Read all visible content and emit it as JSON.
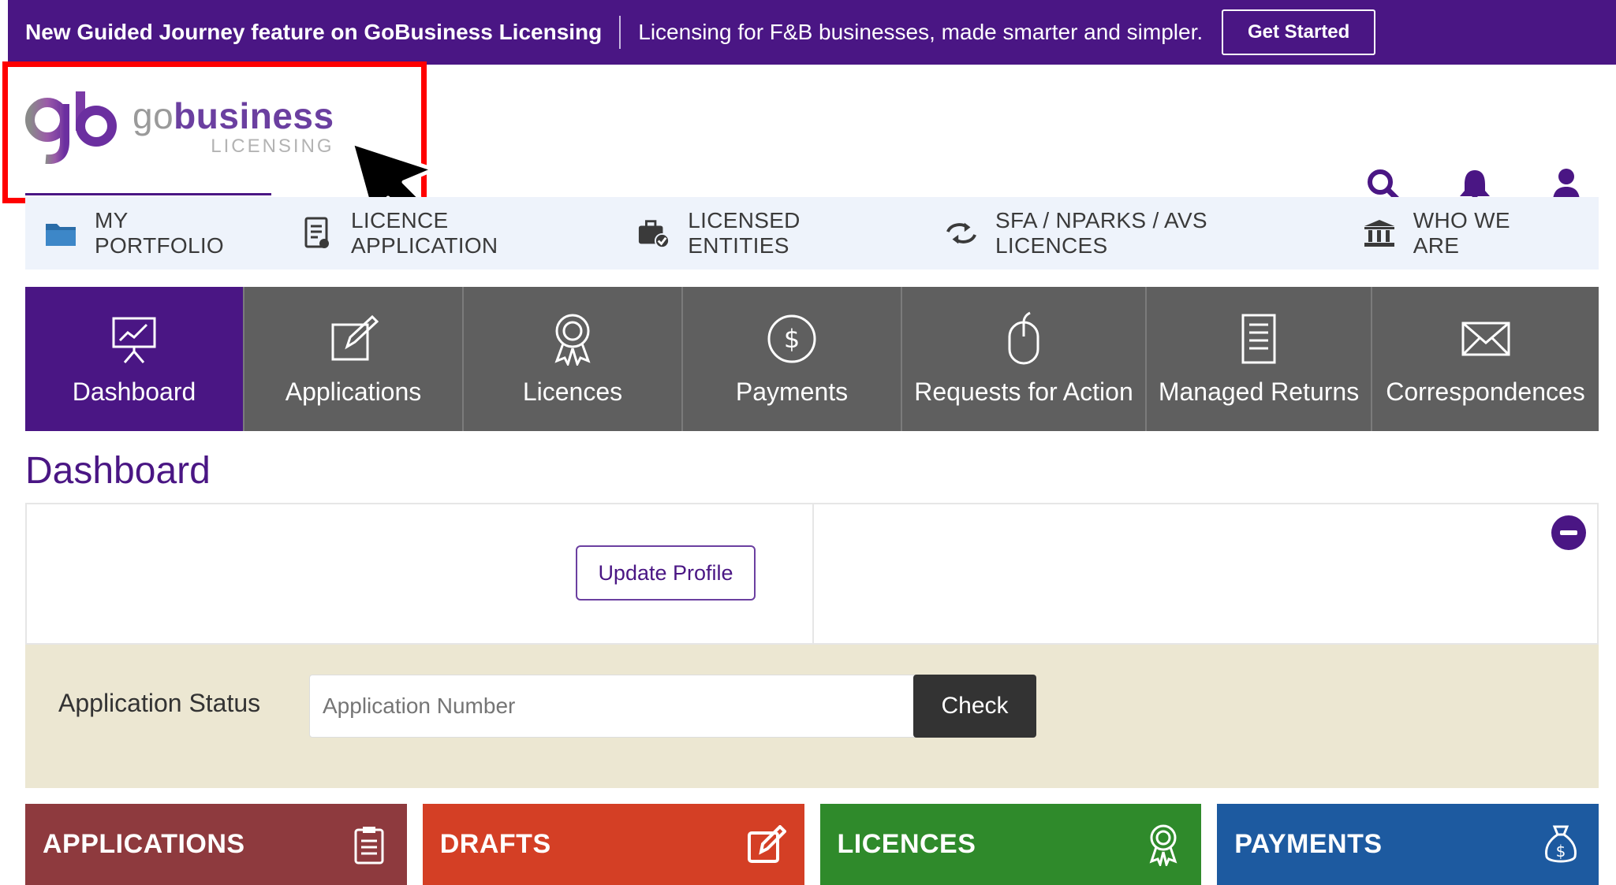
{
  "announcement": {
    "title": "New Guided Journey feature on GoBusiness Licensing",
    "description": "Licensing for F&B businesses, made smarter and simpler.",
    "cta": "Get Started"
  },
  "logo": {
    "word_go": "go",
    "word_business": "business",
    "sub": "LICENSING"
  },
  "main_nav": [
    {
      "label": "MY PORTFOLIO",
      "icon": "folder-icon"
    },
    {
      "label": "LICENCE APPLICATION",
      "icon": "document-icon"
    },
    {
      "label": "LICENSED ENTITIES",
      "icon": "briefcase-check-icon"
    },
    {
      "label": "SFA / NPARKS / AVS LICENCES",
      "icon": "exchange-icon"
    },
    {
      "label": "WHO WE ARE",
      "icon": "institution-icon"
    }
  ],
  "tabs": [
    {
      "label": "Dashboard",
      "icon": "presentation-icon",
      "active": true
    },
    {
      "label": "Applications",
      "icon": "edit-icon",
      "active": false
    },
    {
      "label": "Licences",
      "icon": "award-icon",
      "active": false
    },
    {
      "label": "Payments",
      "icon": "dollar-icon",
      "active": false
    },
    {
      "label": "Requests for Action",
      "icon": "mouse-icon",
      "active": false
    },
    {
      "label": "Managed Returns",
      "icon": "list-doc-icon",
      "active": false
    },
    {
      "label": "Correspondences",
      "icon": "envelope-icon",
      "active": false
    }
  ],
  "page_title": "Dashboard",
  "panel": {
    "update_profile": "Update Profile"
  },
  "status": {
    "label": "Application Status",
    "placeholder": "Application Number",
    "check": "Check"
  },
  "cards": [
    {
      "label": "APPLICATIONS",
      "color": "#8e3a3e",
      "icon": "clipboard-icon"
    },
    {
      "label": "DRAFTS",
      "color": "#d43f25",
      "icon": "edit-icon"
    },
    {
      "label": "LICENCES",
      "color": "#2f8a2b",
      "icon": "award-icon"
    },
    {
      "label": "PAYMENTS",
      "color": "#1d5aa0",
      "icon": "money-bag-icon"
    }
  ],
  "colors": {
    "brand_purple": "#4a1684",
    "tab_gray": "#5f5f5f",
    "status_bg": "#ece7d2"
  }
}
